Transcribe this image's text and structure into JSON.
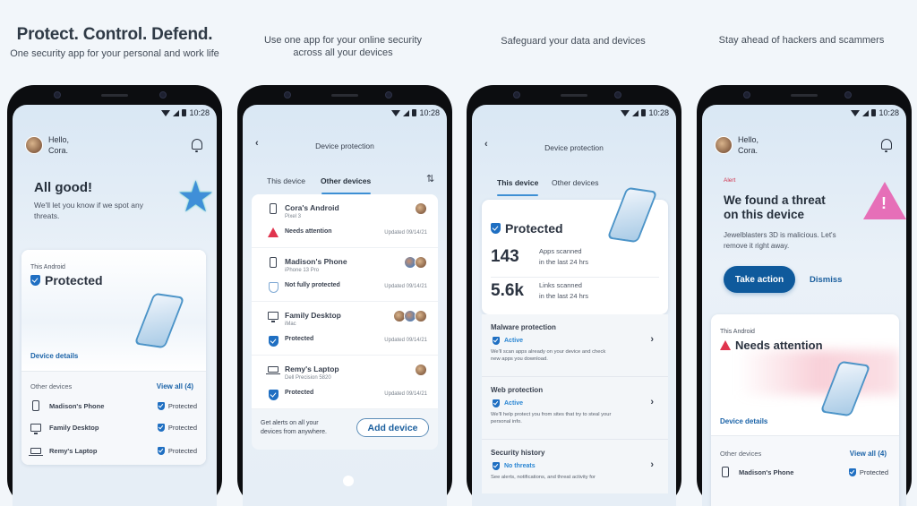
{
  "captions": [
    {
      "title": "Protect. Control. Defend.",
      "subtitle": "One security app for your personal and work life"
    },
    {
      "title": "",
      "subtitle": "Use one app for your online security across all your devices"
    },
    {
      "title": "",
      "subtitle": "Safeguard your data and devices"
    },
    {
      "title": "",
      "subtitle": "Stay ahead of hackers and scammers"
    }
  ],
  "status_bar": {
    "time": "10:28"
  },
  "colors": {
    "accent": "#1f6fc2",
    "primary_button": "#0f5a9c",
    "alert": "#e0344e",
    "tab_underline": "#3d8fd4"
  },
  "screen1": {
    "greeting": "Hello,",
    "user_name": "Cora.",
    "hero_title": "All good!",
    "hero_text": "We'll let you know if we spot any threats.",
    "device_label": "This Android",
    "device_status": "Protected",
    "device_details_link": "Device details",
    "other_devices_label": "Other devices",
    "view_all_link": "View all (4)",
    "other_devices": [
      {
        "name": "Madison's Phone",
        "icon": "phone-icon",
        "status": "Protected"
      },
      {
        "name": "Family Desktop",
        "icon": "desktop-icon",
        "status": "Protected"
      },
      {
        "name": "Remy's Laptop",
        "icon": "laptop-icon",
        "status": "Protected"
      }
    ]
  },
  "screen2": {
    "title": "Device protection",
    "tabs": [
      {
        "label": "This device",
        "active": false
      },
      {
        "label": "Other devices",
        "active": true
      }
    ],
    "devices": [
      {
        "name": "Cora's Android",
        "model": "Pixel 3",
        "icon": "phone-icon",
        "status": "Needs attention",
        "status_icon": "warning-icon",
        "updated": "Updated 09/14/21",
        "avatars": 1
      },
      {
        "name": "Madison's Phone",
        "model": "iPhone 13 Pro",
        "icon": "phone-icon",
        "status": "Not fully protected",
        "status_icon": "shield-outline-icon",
        "updated": "Updated 09/14/21",
        "avatars": 2
      },
      {
        "name": "Family Desktop",
        "model": "iMac",
        "icon": "desktop-icon",
        "status": "Protected",
        "status_icon": "shield-check-icon",
        "updated": "Updated 09/14/21",
        "avatars": 3
      },
      {
        "name": "Remy's Laptop",
        "model": "Dell Precision 5820",
        "icon": "laptop-icon",
        "status": "Protected",
        "status_icon": "shield-check-icon",
        "updated": "Updated 09/14/21",
        "avatars": 1
      }
    ],
    "footer_text": "Get alerts on all your devices from anywhere.",
    "add_device_button": "Add device"
  },
  "screen3": {
    "title": "Device protection",
    "tabs": [
      {
        "label": "This device",
        "active": true
      },
      {
        "label": "Other devices",
        "active": false
      }
    ],
    "status": "Protected",
    "stats": [
      {
        "value": "143",
        "label_line1": "Apps scanned",
        "label_line2": "in the last 24 hrs"
      },
      {
        "value": "5.6k",
        "label_line1": "Links scanned",
        "label_line2": "in the last 24 hrs"
      }
    ],
    "features": [
      {
        "title": "Malware protection",
        "status": "Active",
        "description": "We'll scan apps already on your device and check new apps you download."
      },
      {
        "title": "Web protection",
        "status": "Active",
        "description": "We'll help protect you from sites that try to steal your personal info."
      },
      {
        "title": "Security history",
        "status": "No threats",
        "description": "See alerts, notifications, and threat activity for"
      }
    ]
  },
  "screen4": {
    "greeting": "Hello,",
    "user_name": "Cora.",
    "alert_label": "Alert",
    "alert_title_line1": "We found a threat",
    "alert_title_line2": "on this device",
    "alert_text": "Jewelblasters 3D is malicious. Let's remove it right away.",
    "take_action_button": "Take action",
    "dismiss_button": "Dismiss",
    "device_label": "This Android",
    "device_status": "Needs attention",
    "device_details_link": "Device details",
    "other_devices_label": "Other devices",
    "view_all_link": "View all (4)",
    "other_devices": [
      {
        "name": "Madison's Phone",
        "icon": "phone-icon",
        "status": "Protected"
      }
    ]
  }
}
